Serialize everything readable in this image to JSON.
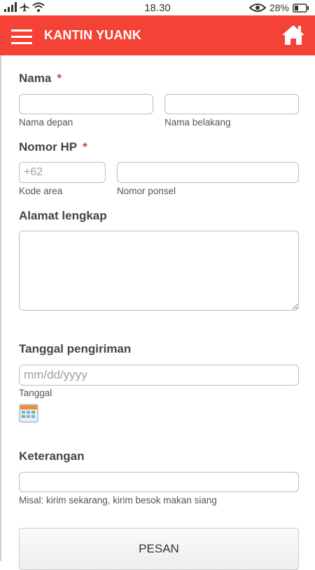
{
  "status_bar": {
    "time": "18.30",
    "battery": "28%"
  },
  "app_bar": {
    "title": "KANTIN YUANK"
  },
  "form": {
    "name": {
      "label": "Nama",
      "required_mark": "*",
      "first_sublabel": "Nama depan",
      "last_sublabel": "Nama belakang",
      "first_value": "",
      "last_value": ""
    },
    "phone": {
      "label": "Nomor HP",
      "required_mark": "*",
      "area_placeholder": "+62",
      "area_sublabel": "Kode area",
      "number_sublabel": "Nomor ponsel",
      "area_value": "",
      "number_value": ""
    },
    "address": {
      "label": "Alamat lengkap",
      "value": ""
    },
    "delivery_date": {
      "label": "Tanggal pengiriman",
      "placeholder": "mm/dd/yyyy",
      "sublabel": "Tanggal",
      "value": ""
    },
    "notes": {
      "label": "Keterangan",
      "sublabel": "Misal: kirim sekarang, kirim besok makan siang",
      "value": ""
    },
    "submit_label": "PESAN"
  },
  "colors": {
    "app_bar": "#f44336",
    "required": "#e53935"
  }
}
